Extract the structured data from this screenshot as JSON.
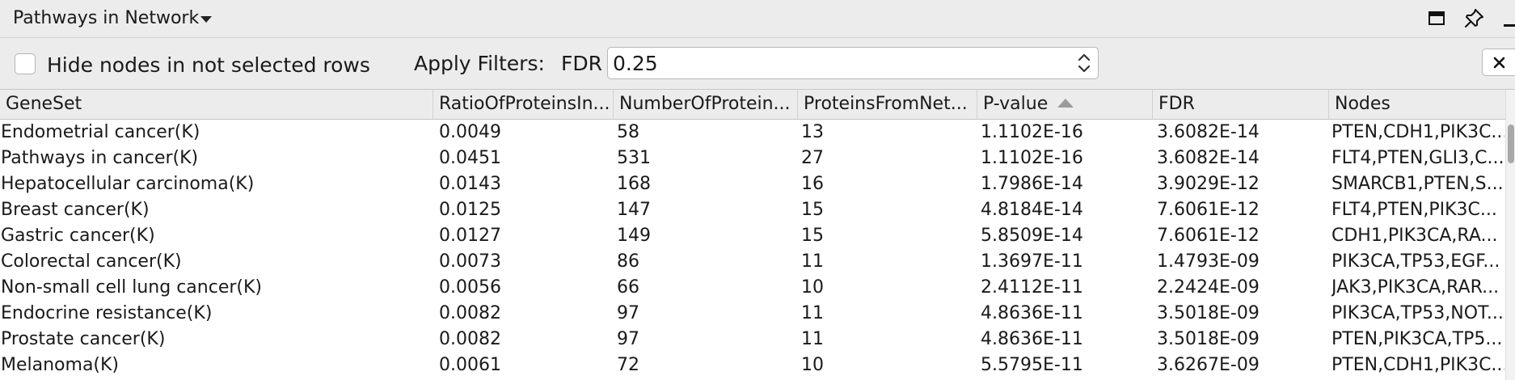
{
  "panel": {
    "title": "Pathways in Network"
  },
  "filters": {
    "hide_label": "Hide nodes in not selected rows",
    "hide_checked": false,
    "apply_label": "Apply Filters:",
    "fdr_label": "FDR",
    "fdr_value": "0.25"
  },
  "table": {
    "columns": [
      {
        "label": "GeneSet"
      },
      {
        "label": "RatioOfProteinsIn..."
      },
      {
        "label": "NumberOfProtein..."
      },
      {
        "label": "ProteinsFromNet..."
      },
      {
        "label": "P-value",
        "sort": "ascending"
      },
      {
        "label": "FDR"
      },
      {
        "label": "Nodes"
      }
    ],
    "rows": [
      {
        "geneset": "Endometrial cancer(K)",
        "ratio": "0.0049",
        "number": "58",
        "from_net": "13",
        "pvalue": "1.1102E-16",
        "fdr": "3.6082E-14",
        "nodes": "PTEN,CDH1,PIK3C..."
      },
      {
        "geneset": "Pathways in cancer(K)",
        "ratio": "0.0451",
        "number": "531",
        "from_net": "27",
        "pvalue": "1.1102E-16",
        "fdr": "3.6082E-14",
        "nodes": "FLT4,PTEN,GLI3,C..."
      },
      {
        "geneset": "Hepatocellular carcinoma(K)",
        "ratio": "0.0143",
        "number": "168",
        "from_net": "16",
        "pvalue": "1.7986E-14",
        "fdr": "3.9029E-12",
        "nodes": "SMARCB1,PTEN,S..."
      },
      {
        "geneset": "Breast cancer(K)",
        "ratio": "0.0125",
        "number": "147",
        "from_net": "15",
        "pvalue": "4.8184E-14",
        "fdr": "7.6061E-12",
        "nodes": "FLT4,PTEN,PIK3C..."
      },
      {
        "geneset": "Gastric cancer(K)",
        "ratio": "0.0127",
        "number": "149",
        "from_net": "15",
        "pvalue": "5.8509E-14",
        "fdr": "7.6061E-12",
        "nodes": "CDH1,PIK3CA,RA..."
      },
      {
        "geneset": "Colorectal cancer(K)",
        "ratio": "0.0073",
        "number": "86",
        "from_net": "11",
        "pvalue": "1.3697E-11",
        "fdr": "1.4793E-09",
        "nodes": "PIK3CA,TP53,EGF..."
      },
      {
        "geneset": "Non-small cell lung cancer(K)",
        "ratio": "0.0056",
        "number": "66",
        "from_net": "10",
        "pvalue": "2.4112E-11",
        "fdr": "2.2424E-09",
        "nodes": "JAK3,PIK3CA,RAR..."
      },
      {
        "geneset": "Endocrine resistance(K)",
        "ratio": "0.0082",
        "number": "97",
        "from_net": "11",
        "pvalue": "4.8636E-11",
        "fdr": "3.5018E-09",
        "nodes": "PIK3CA,TP53,NOT..."
      },
      {
        "geneset": "Prostate cancer(K)",
        "ratio": "0.0082",
        "number": "97",
        "from_net": "11",
        "pvalue": "4.8636E-11",
        "fdr": "3.5018E-09",
        "nodes": "PTEN,PIK3CA,TP5..."
      },
      {
        "geneset": "Melanoma(K)",
        "ratio": "0.0061",
        "number": "72",
        "from_net": "10",
        "pvalue": "5.5795E-11",
        "fdr": "3.6267E-09",
        "nodes": "PTEN,CDH1,PIK3C..."
      }
    ]
  },
  "icons": {
    "title_menu": "chevron-down-icon",
    "maximize": "maximize-icon",
    "pin": "pin-icon",
    "minimize": "minimize-icon",
    "stepper": "stepper-icon",
    "close": "close-icon",
    "sort": "sort-ascending-icon"
  }
}
